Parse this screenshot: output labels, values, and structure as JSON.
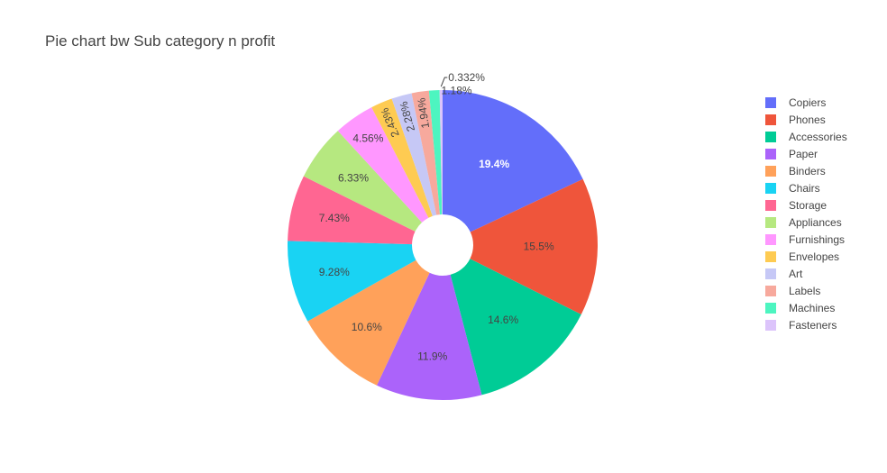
{
  "chart_data": {
    "type": "pie",
    "hole": true,
    "title": "Pie chart bw Sub category n profit",
    "categories": [
      "Copiers",
      "Phones",
      "Accessories",
      "Paper",
      "Binders",
      "Chairs",
      "Storage",
      "Appliances",
      "Furnishings",
      "Envelopes",
      "Art",
      "Labels",
      "Machines",
      "Fasteners"
    ],
    "values": [
      19.4,
      15.5,
      14.6,
      11.9,
      10.6,
      9.28,
      7.43,
      6.33,
      4.56,
      2.43,
      2.28,
      1.94,
      1.18,
      0.332
    ],
    "value_labels": [
      "19.4%",
      "15.5%",
      "14.6%",
      "11.9%",
      "10.6%",
      "9.28%",
      "7.43%",
      "6.33%",
      "4.56%",
      "2.43%",
      "2.28%",
      "1.94%",
      "1.18%",
      "0.332%"
    ],
    "colors": [
      "#636efa",
      "#EF553B",
      "#00cc96",
      "#ab63fa",
      "#FFA15A",
      "#19d3f3",
      "#FF6692",
      "#B6E880",
      "#FF97FF",
      "#FECB52",
      "#c6c8f6",
      "#f7a99d",
      "#4df5c0",
      "#dcc4fb"
    ],
    "legend_position": "right"
  }
}
